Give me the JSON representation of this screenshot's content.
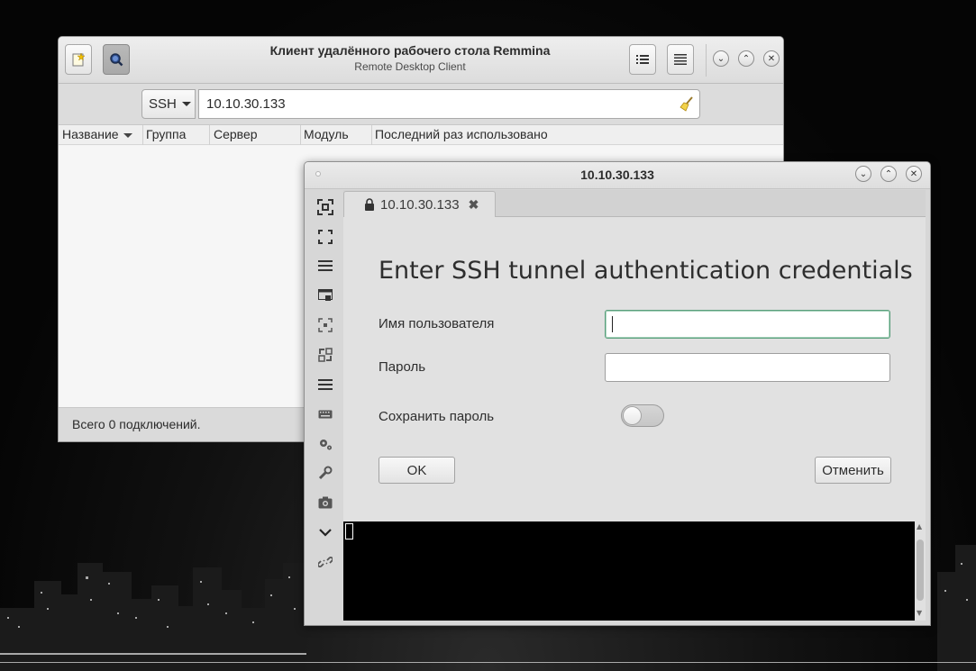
{
  "main_window": {
    "title": "Клиент удалённого рабочего стола Remmina",
    "subtitle": "Remote Desktop Client",
    "toolbar": {
      "new_connection_icon": "new-connection-icon",
      "search_icon": "search-icon",
      "view_list_icon": "list-view-icon",
      "menu_icon": "menu-icon"
    },
    "window_controls": [
      "minimize",
      "maximize",
      "close"
    ],
    "protocol_select": "SSH",
    "server_input_value": "10.10.30.133",
    "columns": [
      "Название",
      "Группа",
      "Сервер",
      "Модуль",
      "Последний раз использовано"
    ],
    "status": "Всего 0 подключений."
  },
  "connection_window": {
    "title": "10.10.30.133",
    "tab": {
      "label": "10.10.30.133",
      "close": "✖"
    },
    "toolbar_icons": [
      "viewport-fullscreen-icon",
      "fullscreen-icon",
      "menu-lines-icon",
      "multi-monitor-icon",
      "scale-fit-icon",
      "scale-expand-icon",
      "menu-lines-icon-2",
      "keyboard-icon",
      "preferences-icon",
      "tools-icon",
      "screenshot-icon",
      "minimize-chevron-icon",
      "disconnect-icon"
    ],
    "auth": {
      "heading": "Enter SSH tunnel authentication credentials",
      "username_label": "Имя пользователя",
      "username_value": "",
      "password_label": "Пароль",
      "password_value": "",
      "save_password_label": "Сохранить пароль",
      "save_password_on": false,
      "ok_button": "OK",
      "cancel_button": "Отменить"
    }
  }
}
